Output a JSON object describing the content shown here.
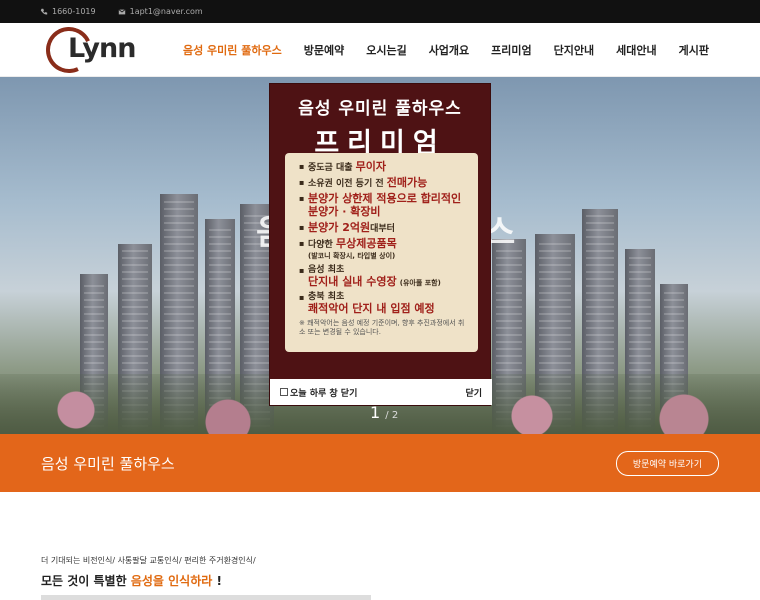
{
  "topbar": {
    "phone": "1660-1019",
    "email": "1apt1@naver.com"
  },
  "logo": {
    "text": "Lynn"
  },
  "nav": {
    "items": [
      "음성 우미린 풀하우스",
      "방문예약",
      "오시는길",
      "사업개요",
      "프리미엄",
      "단지안내",
      "세대안내",
      "게시판"
    ]
  },
  "popup": {
    "title": "음성 우미린 풀하우스",
    "subtitle": "프리미엄",
    "bullets": [
      {
        "pre": "중도금 대출 ",
        "em": "무이자",
        "post": ""
      },
      {
        "pre": "소유권 이전 등기 전 ",
        "em": "전매가능",
        "post": ""
      },
      {
        "pre": "",
        "em": "분양가 상한제 적용으로 합리적인 분양가 · 확장비",
        "post": ""
      },
      {
        "pre": "",
        "em": "분양가 2억원",
        "post": "대부터"
      },
      {
        "pre": "다양한 ",
        "em": "무상제공품목",
        "post": "",
        "small": "(발코니 확장시, 타입별 상이)"
      },
      {
        "pre": "음성 최초 ",
        "em": "단지내 실내 수영장",
        "post": "",
        "small": "(유아풀 포함)"
      },
      {
        "pre": "충북 최초 ",
        "em": "쾌적악어 단지 내 입점 예정",
        "post": ""
      }
    ],
    "note": "※ 쾌적악어는 음성 예정 기준이며, 향후 추진과정에서 취소 또는 변경될 수 있습니다.",
    "dont_show": "오늘 하루 창 닫기",
    "close": "닫기"
  },
  "hero": {
    "ghost_left": "음",
    "ghost_right": "스",
    "page_current": "1",
    "page_total": "/ 2"
  },
  "banner": {
    "title": "음성 우미린 풀하우스",
    "button": "방문예약 바로가기"
  },
  "section": {
    "subtitle": "더 기대되는 비전인식/ 사통팔달 교통인식/ 편리한 주거환경인식/",
    "headline_pre": "모든 것이 특별한 ",
    "headline_hl": "음성을 인식하라",
    "headline_post": " !"
  }
}
